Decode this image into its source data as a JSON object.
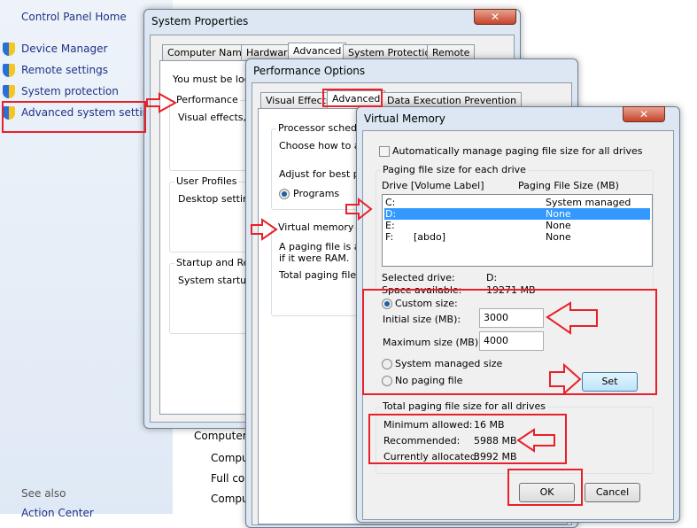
{
  "control_panel": {
    "home": "Control Panel Home",
    "links": [
      "Device Manager",
      "Remote settings",
      "System protection",
      "Advanced system settings"
    ],
    "see_also": "See also",
    "action_center": "Action Center",
    "bg_texts": [
      "Computer",
      "Compu",
      "Full co",
      "Compu"
    ]
  },
  "system_properties": {
    "title": "System Properties",
    "tabs": [
      "Computer Name",
      "Hardware",
      "Advanced",
      "System Protection",
      "Remote"
    ],
    "active_tab": "Advanced",
    "logged_text": "You must be logg",
    "performance_label": "Performance",
    "performance_text": "Visual effects, p",
    "user_profiles_label": "User Profiles",
    "user_profiles_text": "Desktop settings",
    "startup_label": "Startup and Rec",
    "startup_text": "System startup, s"
  },
  "performance_options": {
    "title": "Performance Options",
    "tabs": [
      "Visual Effects",
      "Advanced",
      "Data Execution Prevention"
    ],
    "active_tab": "Advanced",
    "processor_label": "Processor scheduli",
    "processor_text": "Choose how to all",
    "adjust_text": "Adjust for best pe",
    "programs": "Programs",
    "vm_label": "Virtual memory",
    "vm_text1": "A paging file is an",
    "vm_text2": "if it were RAM.",
    "vm_text3": "Total paging file si"
  },
  "virtual_memory": {
    "title": "Virtual Memory",
    "close": "✕",
    "auto_manage": "Automatically manage paging file size for all drives",
    "auto_manage_checked": false,
    "each_drive_label": "Paging file size for each drive",
    "col_drive": "Drive  [Volume Label]",
    "col_size": "Paging File Size (MB)",
    "drives": [
      {
        "drive": "C:",
        "label": "",
        "size": "System managed"
      },
      {
        "drive": "D:",
        "label": "",
        "size": "None",
        "selected": true
      },
      {
        "drive": "E:",
        "label": "",
        "size": "None"
      },
      {
        "drive": "F:",
        "label": "[abdo]",
        "size": "None"
      }
    ],
    "selected_drive_label": "Selected drive:",
    "selected_drive": "D:",
    "space_label": "Space available:",
    "space": "19271 MB",
    "custom_size": "Custom size:",
    "initial_label": "Initial size (MB):",
    "initial_value": "3000",
    "max_label": "Maximum size (MB):",
    "max_value": "4000",
    "system_managed": "System managed size",
    "no_paging": "No paging file",
    "selected_option": "Custom size",
    "set": "Set",
    "total_label": "Total paging file size for all drives",
    "min_label": "Minimum allowed:",
    "min_value": "16 MB",
    "rec_label": "Recommended:",
    "rec_value": "5988 MB",
    "alloc_label": "Currently allocated:",
    "alloc_value": "3992 MB",
    "ok": "OK",
    "cancel": "Cancel"
  },
  "colors": {
    "annotation": "#e8202a",
    "selection": "#3399ff",
    "link": "#1e3287"
  }
}
